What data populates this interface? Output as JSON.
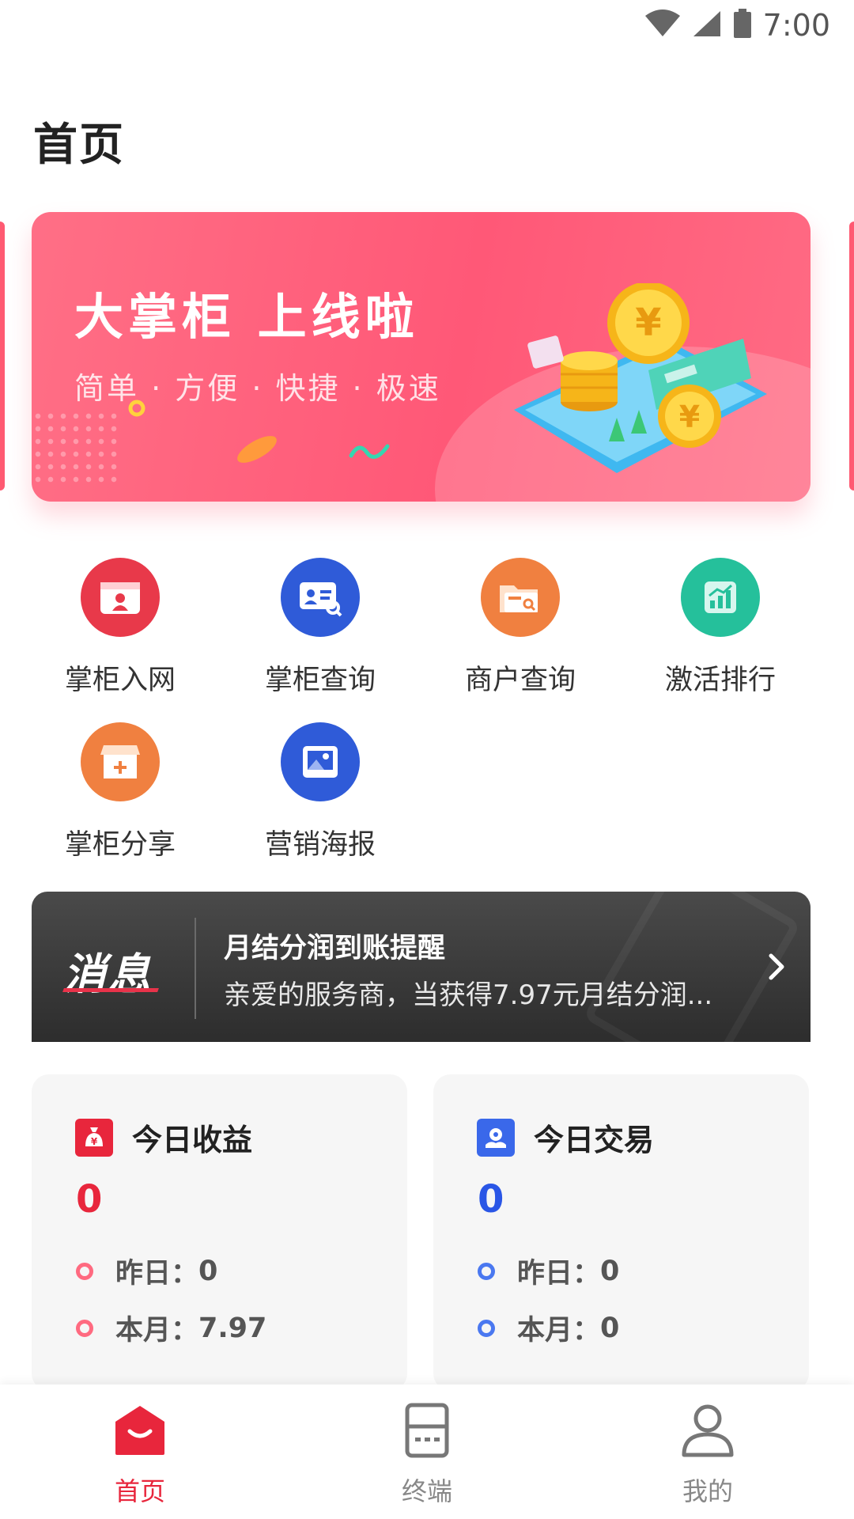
{
  "status_bar": {
    "time": "7:00",
    "icons": [
      "wifi-icon",
      "signal-icon",
      "battery-icon"
    ]
  },
  "header": {
    "title": "首页"
  },
  "banner": {
    "headline": "大掌柜 上线啦",
    "subtitle": "简单 · 方便 · 快捷 · 极速",
    "colors": {
      "bg": "#ff5877",
      "text": "#ffffff"
    }
  },
  "menu": {
    "items": [
      {
        "label": "掌柜入网",
        "icon": "store-entry-icon",
        "color": "#e8394a"
      },
      {
        "label": "掌柜查询",
        "icon": "id-card-search-icon",
        "color": "#2f5bd8"
      },
      {
        "label": "商户查询",
        "icon": "folder-search-icon",
        "color": "#f08040"
      },
      {
        "label": "激活排行",
        "icon": "chart-icon",
        "color": "#25c09b"
      },
      {
        "label": "掌柜分享",
        "icon": "shop-share-icon",
        "color": "#f08040"
      },
      {
        "label": "营销海报",
        "icon": "image-poster-icon",
        "color": "#2f5bd8"
      }
    ]
  },
  "message": {
    "logo": "消息",
    "title": "月结分润到账提醒",
    "text": "亲爱的服务商，当获得7.97元月结分润..."
  },
  "stats": {
    "income": {
      "title": "今日收益",
      "value": "0",
      "yesterday_label": "昨日：",
      "yesterday": "0",
      "month_label": "本月：",
      "month": "7.97",
      "accent": "#e8263c"
    },
    "trade": {
      "title": "今日交易",
      "value": "0",
      "yesterday_label": "昨日：",
      "yesterday": "0",
      "month_label": "本月：",
      "month": "0",
      "accent": "#2a56e6"
    }
  },
  "bottom_nav": {
    "items": [
      {
        "label": "首页",
        "icon": "home-icon",
        "active": true
      },
      {
        "label": "终端",
        "icon": "terminal-icon",
        "active": false
      },
      {
        "label": "我的",
        "icon": "profile-icon",
        "active": false
      }
    ],
    "active_color": "#e8263c",
    "inactive_color": "#888888"
  }
}
